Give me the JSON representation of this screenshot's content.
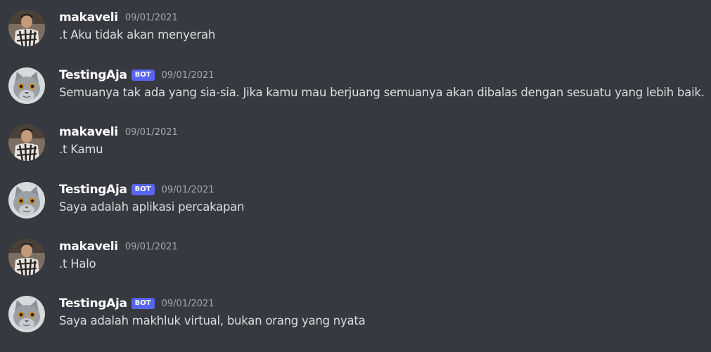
{
  "colors": {
    "background": "#36393f",
    "username": "#ffffff",
    "text": "#dcddde",
    "timestamp": "#a3a6aa",
    "bot_tag": "#5865f2"
  },
  "messages": [
    {
      "author": "makaveli",
      "is_bot": false,
      "timestamp": "09/01/2021",
      "text": ".t Aku tidak akan menyerah",
      "avatar_icon": "user-photo-avatar"
    },
    {
      "author": "TestingAja",
      "is_bot": true,
      "bot_label": "BOT",
      "timestamp": "09/01/2021",
      "text": "Semuanya tak ada yang sia-sia. Jika kamu mau berjuang semuanya akan dibalas dengan sesuatu yang lebih baik.",
      "avatar_icon": "cat-avatar"
    },
    {
      "author": "makaveli",
      "is_bot": false,
      "timestamp": "09/01/2021",
      "text": ".t Kamu",
      "avatar_icon": "user-photo-avatar"
    },
    {
      "author": "TestingAja",
      "is_bot": true,
      "bot_label": "BOT",
      "timestamp": "09/01/2021",
      "text": "Saya adalah aplikasi percakapan",
      "avatar_icon": "cat-avatar"
    },
    {
      "author": "makaveli",
      "is_bot": false,
      "timestamp": "09/01/2021",
      "text": ".t Halo",
      "avatar_icon": "user-photo-avatar"
    },
    {
      "author": "TestingAja",
      "is_bot": true,
      "bot_label": "BOT",
      "timestamp": "09/01/2021",
      "text": "Saya adalah makhluk virtual, bukan orang yang nyata",
      "avatar_icon": "cat-avatar"
    }
  ]
}
